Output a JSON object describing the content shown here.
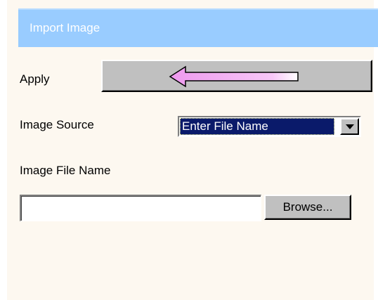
{
  "panel": {
    "title": "Import Image"
  },
  "apply": {
    "label": "Apply",
    "button_icon": "arrow-left-icon",
    "icon_color": "#ee99ee"
  },
  "image_source": {
    "label": "Image Source",
    "selected": "Enter File Name",
    "dropdown_icon": "chevron-down-icon"
  },
  "image_file_name": {
    "label": "Image File Name",
    "value": "",
    "placeholder": "",
    "browse_label": "Browse..."
  },
  "colors": {
    "title_bar": "#99ccff",
    "panel_background": "#fdf8f0",
    "button_face": "#c0c0c0",
    "selection": "#0a1a6a"
  }
}
